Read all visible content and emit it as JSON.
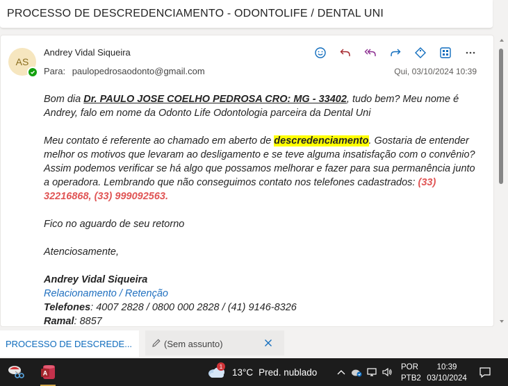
{
  "subject": "PROCESSO DE DESCREDENCIAMENTO - ODONTOLIFE / DENTAL UNI",
  "message": {
    "avatar_initials": "AS",
    "sender": "Andrey Vidal Siqueira",
    "to_label": "Para:",
    "to_address": "paulopedrosaodonto@gmail.com",
    "date": "Qui, 03/10/2024 10:39",
    "toolbar_icons": [
      "smiley-icon",
      "reply-icon",
      "reply-all-icon",
      "forward-icon",
      "tag-icon",
      "apps-icon",
      "more-icon"
    ],
    "body": {
      "p1_a": "Bom dia ",
      "p1_dr": "Dr. PAULO JOSE COELHO PEDROSA CRO: MG - 33402",
      "p1_b": ", tudo bem? Meu nome é Andrey, falo em nome da Odonto Life Odontologia parceira da Dental Uni",
      "p2_a": "Meu contato é referente ao chamado em aberto de ",
      "p2_hl": "descredenciamento",
      "p2_b": ". Gostaria de entender melhor os motivos que levaram ao desligamento e se teve alguma insatisfação com o convênio? Assim podemos verificar se há algo que possamos melhorar e fazer para sua permanência junto a operadora. Lembrando que não conseguimos contato nos telefones cadastrados: ",
      "p2_phones": "(33) 32216868, (33) 999092563.",
      "p3": "Fico no aguardo de seu retorno",
      "p4": "Atenciosamente,",
      "sig_name": "Andrey Vidal Siqueira",
      "sig_dept": "Relacionamento / Retenção",
      "sig_phones_label": "Telefones",
      "sig_phones": ": 4007 2828 / 0800 000 2828 / (41) 9146-8326",
      "sig_ramal_label": "Ramal",
      "sig_ramal": ": 8857"
    }
  },
  "tabs": [
    {
      "label": "PROCESSO DE DESCREDE..."
    },
    {
      "label": "(Sem assunto)"
    }
  ],
  "taskbar": {
    "weather_badge": "1",
    "temperature": "13°C",
    "weather_desc": "Pred. nublado",
    "lang_line1": "POR",
    "lang_line2": "PTB2",
    "time": "10:39",
    "date": "03/10/2024"
  },
  "colors": {
    "accent": "#0f6cbd",
    "highlight": "#ffff00",
    "phones": "#e05555",
    "taskbar": "#1c1c1c"
  }
}
